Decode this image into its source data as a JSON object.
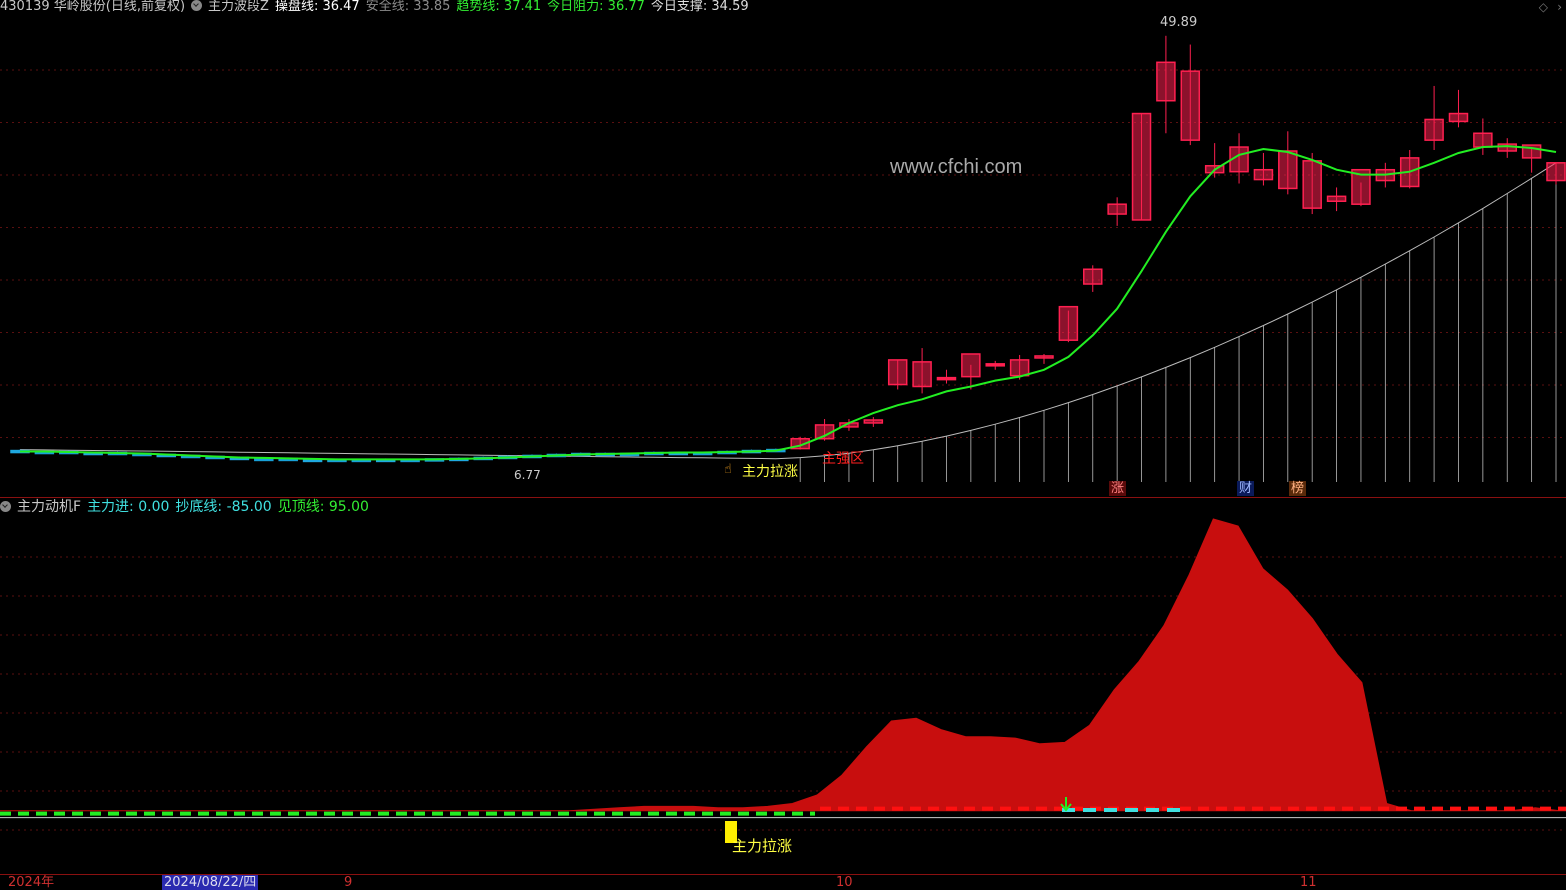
{
  "top_header": {
    "stock": "430139 华岭股份(日线,前复权)",
    "indicator_name": "主力波段Z",
    "caopan_label": "操盘线: 36.47",
    "anquan_label": "安全线: 33.85",
    "qushi_label": "趋势线: 37.41",
    "zuli_label": "今日阻力: 36.77",
    "zhicheng_label": "今日支撑: 34.59",
    "colors": {
      "stock": "#c8c8c8",
      "caopan": "#ffffff",
      "anquan": "#8c8c8c",
      "qushi": "#33ee33",
      "zuli": "#33ee33",
      "zhicheng": "#dddddd"
    }
  },
  "main_chart": {
    "watermark": "www.cfchi.com",
    "high_label": "49.89",
    "low_label": "6.77",
    "signal_label": "主力拉涨",
    "zone_label": "主强区",
    "markers": [
      "涨",
      "财",
      "榜"
    ]
  },
  "sub_header": {
    "name": "主力动机F",
    "zhulijin_label": "主力进: 0.00",
    "chaodi_label": "抄底线: -85.00",
    "jianding_label": "见顶线: 95.00"
  },
  "sub_chart": {
    "signal_label": "主力拉涨"
  },
  "x_axis": {
    "labels": [
      "2024年",
      "2024/08/22/四",
      "9",
      "10",
      "11"
    ]
  },
  "icons": {
    "top_right": "diamond-icon",
    "collapse": "chevron-circle-icon"
  },
  "chart_data": {
    "type": "candlestick",
    "y_range": [
      4,
      52
    ],
    "price_high": 49.89,
    "price_low": 6.77,
    "candles": [
      [
        7.8,
        7.9,
        7.6,
        7.7
      ],
      [
        7.7,
        7.8,
        7.6,
        7.7
      ],
      [
        7.7,
        7.8,
        7.5,
        7.6
      ],
      [
        7.6,
        7.7,
        7.5,
        7.6
      ],
      [
        7.6,
        7.7,
        7.4,
        7.5
      ],
      [
        7.5,
        7.6,
        7.3,
        7.4
      ],
      [
        7.4,
        7.5,
        7.2,
        7.3
      ],
      [
        7.3,
        7.4,
        7.1,
        7.2
      ],
      [
        7.2,
        7.3,
        7.0,
        7.1
      ],
      [
        7.1,
        7.2,
        6.9,
        7.0
      ],
      [
        7.0,
        7.1,
        6.9,
        7.0
      ],
      [
        7.0,
        7.1,
        6.8,
        6.9
      ],
      [
        6.9,
        7.0,
        6.8,
        6.9
      ],
      [
        6.9,
        7.0,
        6.77,
        6.85
      ],
      [
        6.85,
        6.95,
        6.8,
        6.9
      ],
      [
        6.9,
        7.0,
        6.8,
        6.9
      ],
      [
        6.9,
        7.0,
        6.8,
        6.9
      ],
      [
        6.9,
        7.0,
        6.8,
        6.95
      ],
      [
        6.95,
        7.1,
        6.85,
        7.0
      ],
      [
        7.0,
        7.2,
        6.9,
        7.1
      ],
      [
        7.1,
        7.3,
        7.0,
        7.2
      ],
      [
        7.2,
        7.4,
        7.1,
        7.3
      ],
      [
        7.3,
        7.5,
        7.2,
        7.4
      ],
      [
        7.4,
        7.6,
        7.3,
        7.5
      ],
      [
        7.5,
        7.6,
        7.3,
        7.4
      ],
      [
        7.4,
        7.6,
        7.3,
        7.5
      ],
      [
        7.5,
        7.7,
        7.4,
        7.6
      ],
      [
        7.6,
        7.7,
        7.4,
        7.5
      ],
      [
        7.5,
        7.7,
        7.4,
        7.6
      ],
      [
        7.6,
        7.8,
        7.5,
        7.7
      ],
      [
        7.7,
        7.9,
        7.6,
        7.8
      ],
      [
        7.8,
        8.0,
        7.7,
        7.9
      ],
      [
        8.0,
        9.2,
        7.9,
        9.0
      ],
      [
        9.0,
        11.0,
        8.8,
        10.4
      ],
      [
        10.2,
        11.0,
        9.8,
        10.6
      ],
      [
        10.6,
        11.2,
        10.2,
        10.9
      ],
      [
        14.5,
        17.0,
        14.0,
        17.0
      ],
      [
        14.3,
        18.2,
        13.6,
        16.8
      ],
      [
        15.2,
        16.0,
        14.6,
        15.0
      ],
      [
        15.3,
        16.5,
        14.0,
        17.6
      ],
      [
        16.6,
        16.9,
        16.0,
        16.5
      ],
      [
        15.4,
        17.5,
        15.0,
        17.0
      ],
      [
        17.2,
        17.6,
        16.6,
        17.4
      ],
      [
        19.0,
        22.0,
        18.8,
        22.4
      ],
      [
        24.7,
        26.6,
        23.9,
        26.2
      ],
      [
        31.8,
        33.5,
        30.6,
        32.8
      ],
      [
        31.2,
        42.0,
        31.2,
        42.0
      ],
      [
        43.3,
        49.89,
        40.0,
        47.2
      ],
      [
        39.3,
        49.0,
        38.8,
        46.3
      ],
      [
        36.0,
        39.0,
        35.5,
        36.7
      ],
      [
        36.1,
        40.0,
        34.9,
        38.6
      ],
      [
        35.3,
        38.0,
        34.7,
        36.3
      ],
      [
        34.4,
        40.2,
        33.8,
        38.2
      ],
      [
        32.4,
        38.0,
        31.8,
        37.2
      ],
      [
        33.1,
        34.5,
        32.1,
        33.6
      ],
      [
        32.8,
        35.0,
        32.6,
        36.3
      ],
      [
        35.2,
        37.0,
        34.5,
        36.3
      ],
      [
        34.6,
        38.3,
        34.4,
        37.5
      ],
      [
        39.3,
        44.8,
        38.3,
        41.4
      ],
      [
        41.2,
        44.4,
        40.6,
        42.0
      ],
      [
        38.6,
        41.5,
        37.8,
        40.0
      ],
      [
        38.2,
        39.5,
        37.5,
        38.9
      ],
      [
        37.5,
        38.5,
        36.0,
        38.8
      ],
      [
        35.2,
        37.0,
        34.8,
        37.0
      ]
    ],
    "trend_line": [
      7.7,
      7.7,
      7.65,
      7.6,
      7.55,
      7.5,
      7.4,
      7.3,
      7.2,
      7.1,
      7.05,
      7.0,
      6.95,
      6.9,
      6.9,
      6.9,
      6.9,
      6.9,
      6.95,
      7.0,
      7.1,
      7.2,
      7.3,
      7.4,
      7.45,
      7.5,
      7.55,
      7.6,
      7.6,
      7.65,
      7.7,
      7.8,
      8.3,
      9.3,
      10.6,
      11.6,
      12.4,
      13.0,
      13.8,
      14.3,
      14.9,
      15.3,
      16.0,
      17.3,
      19.5,
      22.2,
      26.0,
      30.0,
      33.6,
      36.3,
      37.8,
      38.4,
      38.1,
      37.3,
      36.3,
      35.8,
      35.8,
      36.1,
      37.0,
      38.0,
      38.6,
      38.7,
      38.5,
      38.1
    ],
    "sub_chart": {
      "y_range": [
        -100,
        120
      ],
      "area_values": [
        -85,
        -85,
        -85,
        -85,
        -85,
        -85,
        -85,
        -85,
        -85,
        -85,
        -85,
        -85,
        -85,
        -85,
        -85,
        -85,
        -85,
        -85,
        -85,
        -85,
        -85,
        -85,
        -85,
        -85,
        -84,
        -83,
        -82,
        -82,
        -82,
        -83,
        -83,
        -82,
        -80,
        -74,
        -60,
        -40,
        -22,
        -20,
        -28,
        -33,
        -33,
        -34,
        -38,
        -37,
        -25,
        0,
        20,
        45,
        80,
        120,
        115,
        85,
        70,
        50,
        25,
        5,
        -80,
        -85,
        -85,
        -85,
        -85,
        -85,
        -83,
        -85
      ],
      "zhulijin": 0.0,
      "chaodi": -85.0,
      "jianding": 95.0
    }
  }
}
